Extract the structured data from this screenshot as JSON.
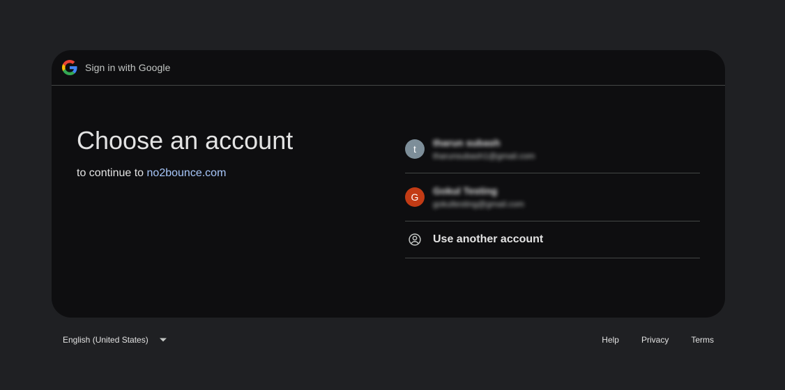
{
  "header": {
    "title": "Sign in with Google",
    "logo_icon": "google-g-icon"
  },
  "main": {
    "headline": "Choose an account",
    "subline_prefix": "to continue to",
    "site": "no2bounce.com"
  },
  "accounts": [
    {
      "initial": "t",
      "name": "tharun subash",
      "email": "tharunsubash1@gmail.com",
      "avatar_color": "#7d8e99"
    },
    {
      "initial": "G",
      "name": "Gokul Testing",
      "email": "gokultesting@gmail.com",
      "avatar_color": "#c23b15"
    }
  ],
  "another_account": {
    "label": "Use another account",
    "icon": "account-circle-icon"
  },
  "footer": {
    "language": "English (United States)",
    "links": [
      "Help",
      "Privacy",
      "Terms"
    ]
  }
}
